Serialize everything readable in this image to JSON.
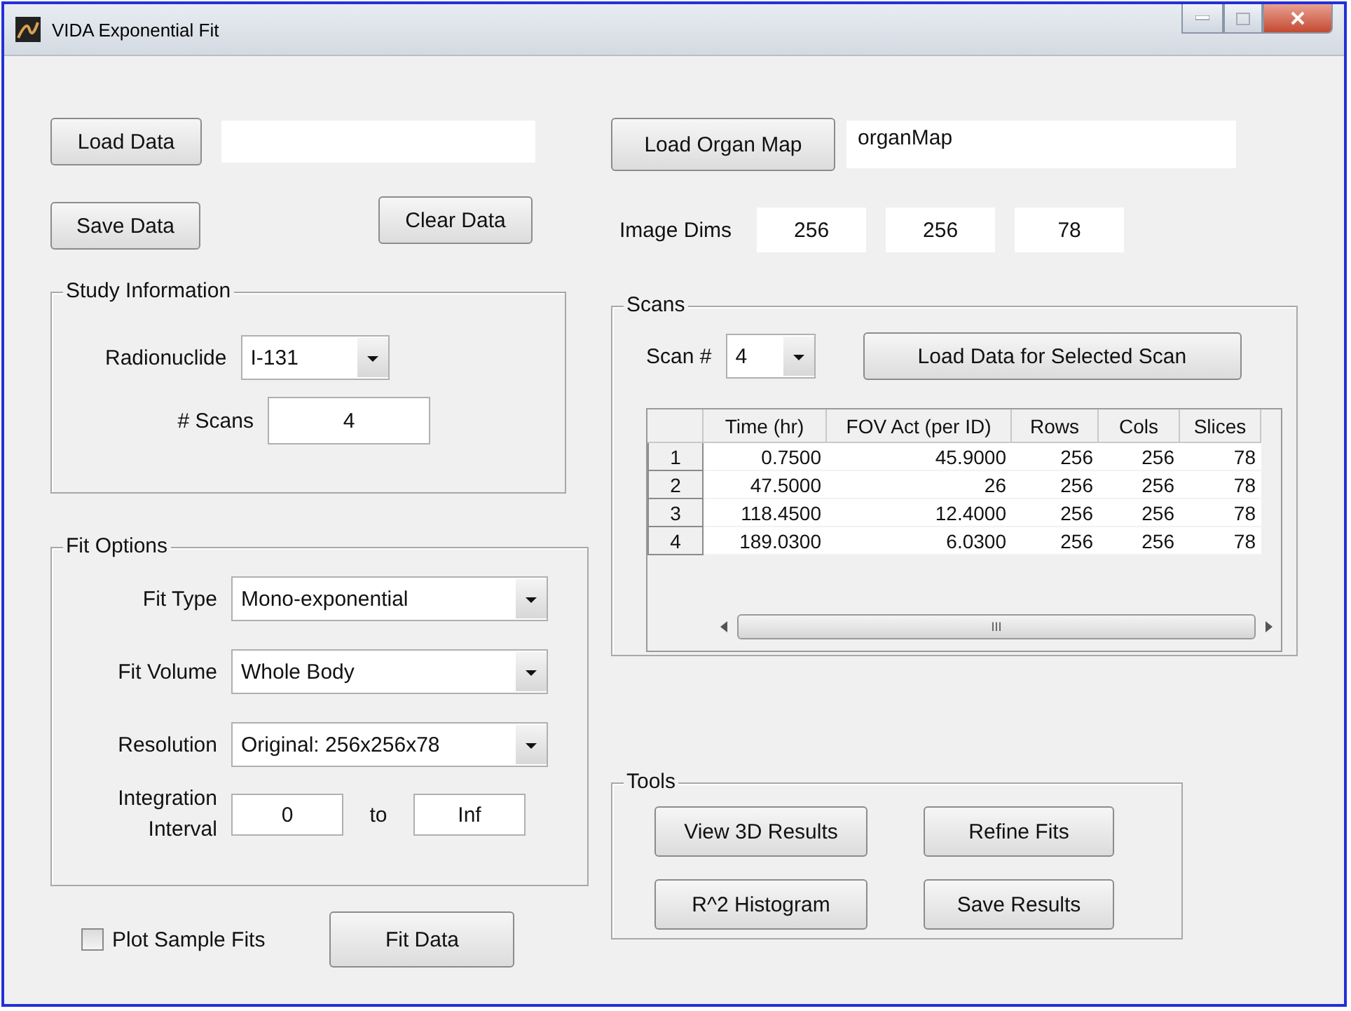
{
  "window": {
    "title": "VIDA Exponential Fit"
  },
  "load_data": {
    "button": "Load Data"
  },
  "save_data": "Save Data",
  "clear_data": "Clear Data",
  "study_information": {
    "title": "Study Information",
    "radionuclide_label": "Radionuclide",
    "radionuclide": "I-131",
    "scans_label": "# Scans",
    "scans": "4"
  },
  "fit_options": {
    "title": "Fit Options",
    "fields": [
      {
        "label": "Fit Type",
        "value": "Mono-exponential"
      },
      {
        "label": "Fit Volume",
        "value": "Whole Body"
      },
      {
        "label": "Resolution",
        "value": "Original: 256x256x78"
      }
    ],
    "interval_label": "Integration Interval",
    "interval_from": "0",
    "interval_to_label": "to",
    "interval_to": "Inf"
  },
  "plot_sample_fits": {
    "label": "Plot Sample Fits",
    "checked": false
  },
  "fit_data": "Fit Data",
  "organ_map": {
    "button": "Load Organ Map",
    "value": "organMap"
  },
  "image_dims": {
    "label": "Image Dims",
    "values": [
      "256",
      "256",
      "78"
    ]
  },
  "scans": {
    "title": "Scans",
    "scan_label": "Scan #",
    "scan": "4",
    "load_button": "Load Data for Selected Scan",
    "table": {
      "columns": [
        "Time (hr)",
        "FOV Act (per ID)",
        "Rows",
        "Cols",
        "Slices"
      ],
      "rows": [
        {
          "header": "1",
          "cells": [
            "0.7500",
            "45.9000",
            "256",
            "256",
            "78"
          ]
        },
        {
          "header": "2",
          "cells": [
            "47.5000",
            "26",
            "256",
            "256",
            "78"
          ]
        },
        {
          "header": "3",
          "cells": [
            "118.4500",
            "12.4000",
            "256",
            "256",
            "78"
          ]
        },
        {
          "header": "4",
          "cells": [
            "189.0300",
            "6.0300",
            "256",
            "256",
            "78"
          ]
        }
      ],
      "scroll_grip": "III"
    }
  },
  "tools": {
    "title": "Tools",
    "buttons": [
      "View 3D Results",
      "Refine Fits",
      "R^2 Histogram",
      "Save Results"
    ]
  }
}
